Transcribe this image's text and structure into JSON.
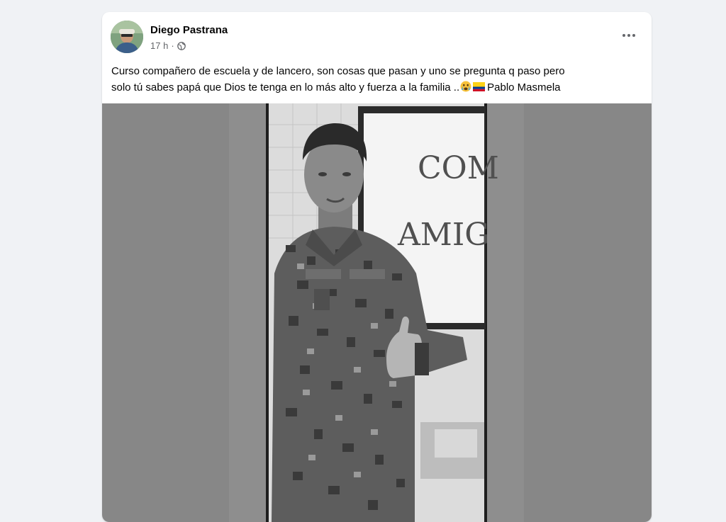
{
  "post": {
    "author": {
      "name": "Diego Pastrana"
    },
    "meta": {
      "time": "17 h",
      "separator": "·",
      "audience_icon": "globe-icon"
    },
    "more_icon": "more-horizontal-icon",
    "text": {
      "line1": "Curso compañero de escuela y de lancero, son cosas que pasan y uno se pregunta q paso pero",
      "line2_before_emoji": "solo tú sabes papá que Dios te tenga en lo más alto y fuerza a la familia ..",
      "emoji1": "crying-face-emoji",
      "emoji2": "colombia-flag-emoji",
      "line2_after_emoji": "Pablo Masmela"
    },
    "photo": {
      "board_text_line1": "COM",
      "board_text_line2": "AMIG",
      "tone": "grayscale"
    }
  },
  "colors": {
    "page_background": "#f0f2f5",
    "card_background": "#ffffff",
    "primary_text": "#050505",
    "secondary_text": "#65676b",
    "media_background": "#878787"
  }
}
